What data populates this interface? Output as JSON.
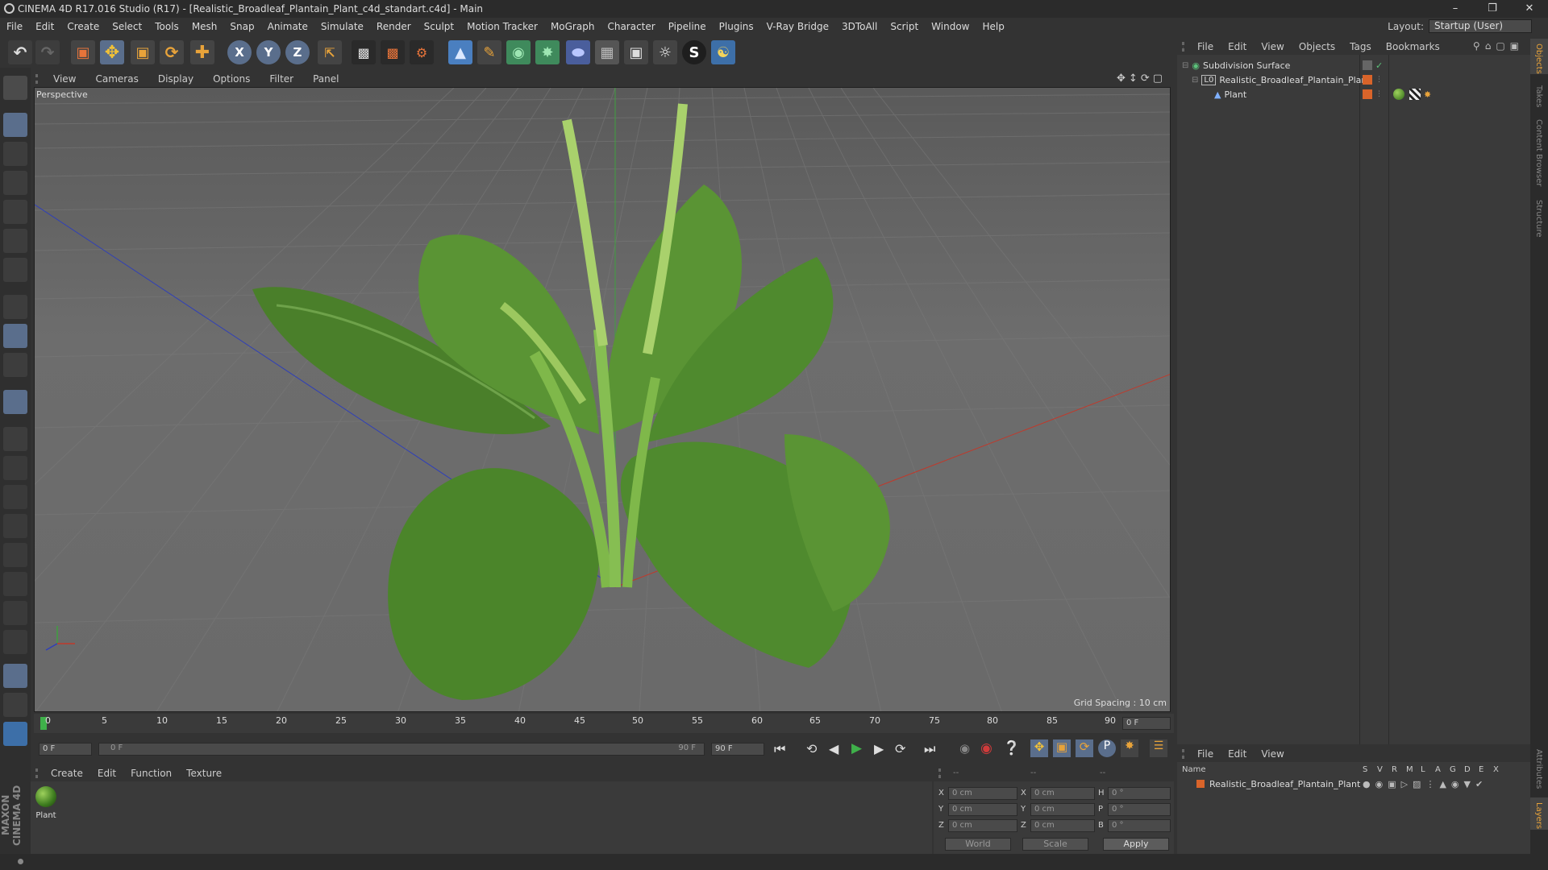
{
  "window": {
    "title": "CINEMA 4D R17.016 Studio (R17) - [Realistic_Broadleaf_Plantain_Plant_c4d_standart.c4d] - Main"
  },
  "menu": [
    "File",
    "Edit",
    "Create",
    "Select",
    "Tools",
    "Mesh",
    "Snap",
    "Animate",
    "Simulate",
    "Render",
    "Sculpt",
    "Motion Tracker",
    "MoGraph",
    "Character",
    "Pipeline",
    "Plugins",
    "V-Ray Bridge",
    "3DToAll",
    "Script",
    "Window",
    "Help"
  ],
  "layout": {
    "label": "Layout:",
    "value": "Startup (User)"
  },
  "viewport": {
    "menu": [
      "View",
      "Cameras",
      "Display",
      "Options",
      "Filter",
      "Panel"
    ],
    "label": "Perspective",
    "grid_spacing": "Grid Spacing : 10 cm"
  },
  "timeline": {
    "ticks": [
      "0",
      "5",
      "10",
      "15",
      "20",
      "25",
      "30",
      "35",
      "40",
      "45",
      "50",
      "55",
      "60",
      "65",
      "70",
      "75",
      "80",
      "85",
      "90"
    ],
    "current": "0 F",
    "start": "0 F",
    "range_start": "0 F",
    "range_end": "90 F",
    "end": "90 F"
  },
  "materials": {
    "menu": [
      "Create",
      "Edit",
      "Function",
      "Texture"
    ],
    "items": [
      {
        "name": "Plant"
      }
    ]
  },
  "coords": {
    "rows": [
      {
        "a": "X",
        "av": "0 cm",
        "b": "X",
        "bv": "0 cm",
        "c": "H",
        "cv": "0 °"
      },
      {
        "a": "Y",
        "av": "0 cm",
        "b": "Y",
        "bv": "0 cm",
        "c": "P",
        "cv": "0 °"
      },
      {
        "a": "Z",
        "av": "0 cm",
        "b": "Z",
        "bv": "0 cm",
        "c": "B",
        "cv": "0 °"
      }
    ],
    "header": [
      "--",
      "--",
      "--"
    ],
    "world": "World",
    "scale": "Scale",
    "apply": "Apply"
  },
  "objects": {
    "menu": [
      "File",
      "Edit",
      "View",
      "Objects",
      "Tags",
      "Bookmarks"
    ],
    "items": [
      {
        "name": "Subdivision Surface"
      },
      {
        "name": "Realistic_Broadleaf_Plantain_Plant"
      },
      {
        "name": "Plant"
      }
    ]
  },
  "layers": {
    "menu": [
      "File",
      "Edit",
      "View"
    ],
    "columns": [
      "Name",
      "S",
      "V",
      "R",
      "M",
      "L",
      "A",
      "G",
      "D",
      "E",
      "X"
    ],
    "items": [
      {
        "name": "Realistic_Broadleaf_Plantain_Plant"
      }
    ]
  },
  "right_tabs": [
    "Objects",
    "Takes",
    "Content Browser",
    "Structure",
    "Attributes",
    "Layers"
  ],
  "brand": {
    "logo_text": "MAXON CINEMA 4D"
  },
  "colors": {
    "accent": "#e8a33a",
    "axis_x": "#c0392b",
    "axis_y": "#3fa03f",
    "axis_z": "#2f3fb8",
    "layer_orange": "#d9642a"
  }
}
